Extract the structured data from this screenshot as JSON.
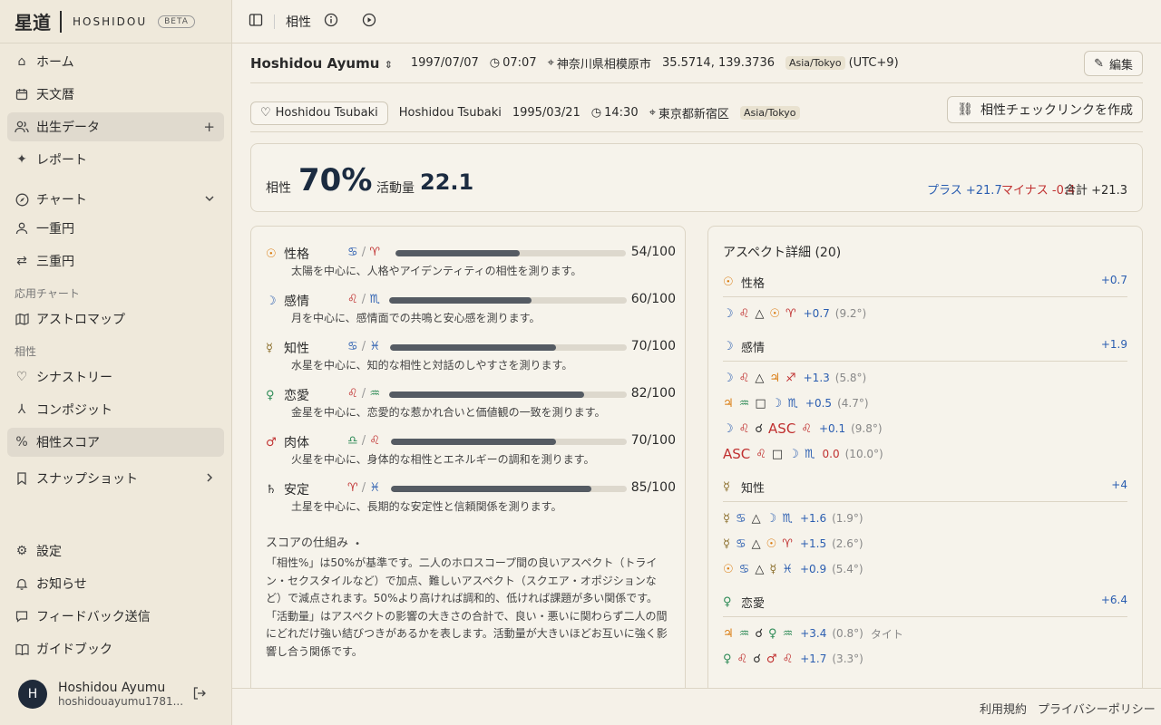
{
  "brand": {
    "kanji": "星道",
    "latin": "HOSHIDOU",
    "beta": "BETA"
  },
  "sidebar": {
    "items": [
      {
        "label": "ホーム",
        "icon": "home-icon"
      },
      {
        "label": "天文暦",
        "icon": "calendar-icon"
      },
      {
        "label": "出生データ",
        "icon": "users-icon"
      },
      {
        "label": "レポート",
        "icon": "sparkles-icon"
      },
      {
        "label": "チャート",
        "icon": "compass-icon"
      },
      {
        "label": "一重円",
        "icon": "user-icon"
      },
      {
        "label": "三重円",
        "icon": "swap-icon"
      },
      {
        "label": "アストロマップ",
        "icon": "map-icon"
      },
      {
        "label": "シナストリー",
        "icon": "heart-icon"
      },
      {
        "label": "コンポジット",
        "icon": "merge-icon"
      },
      {
        "label": "相性スコア",
        "icon": "percent-icon"
      },
      {
        "label": "スナップショット",
        "icon": "bookmark-icon"
      },
      {
        "label": "設定",
        "icon": "gear-icon"
      },
      {
        "label": "お知らせ",
        "icon": "bell-icon"
      },
      {
        "label": "フィードバック送信",
        "icon": "message-icon"
      },
      {
        "label": "ガイドブック",
        "icon": "book-icon"
      }
    ],
    "section_applied": "応用チャート",
    "section_compat": "相性"
  },
  "user": {
    "initial": "H",
    "name": "Hoshidou Ayumu",
    "email": "hoshidouayumu1781..."
  },
  "topbar": {
    "title": "相性"
  },
  "person1": {
    "name": "Hoshidou Ayumu",
    "date": "1997/07/07",
    "time": "07:07",
    "place": "神奈川県相模原市",
    "coords": "35.5714, 139.3736",
    "tz": "Asia/Tokyo",
    "offset": "(UTC+9)",
    "edit_label": "編集"
  },
  "person2": {
    "chip": "Hoshidou Tsubaki",
    "name": "Hoshidou Tsubaki",
    "date": "1995/03/21",
    "time": "14:30",
    "place": "東京都新宿区",
    "tz": "Asia/Tokyo",
    "link_label": "相性チェックリンクを作成"
  },
  "score": {
    "compat_label": "相性",
    "compat_value": "70%",
    "activity_label": "活動量",
    "activity_value": "22.1",
    "plus": "プラス +21.7",
    "minus": "マイナス -0.4",
    "total": "合計 +21.3"
  },
  "categories": [
    {
      "sym": "☉",
      "name": "性格",
      "s1": "♋",
      "s2": "♈",
      "score": 54,
      "label": "54/100",
      "desc": "太陽を中心に、人格やアイデンティティの相性を測ります。"
    },
    {
      "sym": "☽",
      "name": "感情",
      "s1": "♌",
      "s2": "♏",
      "score": 60,
      "label": "60/100",
      "desc": "月を中心に、感情面での共鳴と安心感を測ります。"
    },
    {
      "sym": "☿",
      "name": "知性",
      "s1": "♋",
      "s2": "♓",
      "score": 70,
      "label": "70/100",
      "desc": "水星を中心に、知的な相性と対話のしやすさを測ります。"
    },
    {
      "sym": "♀",
      "name": "恋愛",
      "s1": "♌",
      "s2": "♒",
      "score": 82,
      "label": "82/100",
      "desc": "金星を中心に、恋愛的な惹かれ合いと価値観の一致を測ります。"
    },
    {
      "sym": "♂",
      "name": "肉体",
      "s1": "♎",
      "s2": "♌",
      "score": 70,
      "label": "70/100",
      "desc": "火星を中心に、身体的な相性とエネルギーの調和を測ります。"
    },
    {
      "sym": "♄",
      "name": "安定",
      "s1": "♈",
      "s2": "♓",
      "score": 85,
      "label": "85/100",
      "desc": "土星を中心に、長期的な安定性と信頼関係を測ります。"
    }
  ],
  "explain": {
    "heading": "スコアの仕組み",
    "text": "「相性%」は50%が基準です。二人のホロスコープ間の良いアスペクト（トライン・セクスタイルなど）で加点、難しいアスペクト（スクエア・オポジションなど）で減点されます。50%より高ければ調和的、低ければ課題が多い関係です。「活動量」はアスペクトの影響の大きさの合計で、良い・悪いに関わらず二人の間にどれだけ強い結びつきがあるかを表します。活動量が大きいほどお互いに強く影響し合う関係です。"
  },
  "aspects": {
    "title": "アスペクト詳細 (20)",
    "groups": [
      {
        "sym": "☉",
        "name": "性格",
        "total": "+0.7",
        "rows": [
          {
            "a": "☽",
            "as": "♌",
            "asp": "△",
            "b": "☉",
            "bs": "♈",
            "score": "+0.7",
            "orb": "(9.2°)"
          }
        ]
      },
      {
        "sym": "☽",
        "name": "感情",
        "total": "+1.9",
        "rows": [
          {
            "a": "☽",
            "as": "♌",
            "asp": "△",
            "b": "♃",
            "bs": "♐",
            "score": "+1.3",
            "orb": "(5.8°)"
          },
          {
            "a": "♃",
            "as": "♒",
            "asp": "□",
            "b": "☽",
            "bs": "♏",
            "score": "+0.5",
            "orb": "(4.7°)"
          },
          {
            "a": "☽",
            "as": "♌",
            "asp": "☌",
            "b": "ASC",
            "bs": "♌",
            "score": "+0.1",
            "orb": "(9.8°)"
          },
          {
            "a": "ASC",
            "as": "♌",
            "asp": "□",
            "b": "☽",
            "bs": "♏",
            "score": "0.0",
            "orb": "(10.0°)"
          }
        ]
      },
      {
        "sym": "☿",
        "name": "知性",
        "total": "+4",
        "rows": [
          {
            "a": "☿",
            "as": "♋",
            "asp": "△",
            "b": "☽",
            "bs": "♏",
            "score": "+1.6",
            "orb": "(1.9°)"
          },
          {
            "a": "☿",
            "as": "♋",
            "asp": "△",
            "b": "☉",
            "bs": "♈",
            "score": "+1.5",
            "orb": "(2.6°)"
          },
          {
            "a": "☉",
            "as": "♋",
            "asp": "△",
            "b": "☿",
            "bs": "♓",
            "score": "+0.9",
            "orb": "(5.4°)"
          }
        ]
      },
      {
        "sym": "♀",
        "name": "恋愛",
        "total": "+6.4",
        "rows": [
          {
            "a": "♃",
            "as": "♒",
            "asp": "☌",
            "b": "♀",
            "bs": "♒",
            "score": "+3.4",
            "orb": "(0.8°)",
            "tag": "タイト"
          },
          {
            "a": "♀",
            "as": "♌",
            "asp": "☌",
            "b": "♂",
            "bs": "♌",
            "score": "+1.7",
            "orb": "(3.3°)"
          }
        ]
      }
    ]
  },
  "footer": {
    "terms": "利用規約",
    "privacy": "プライバシーポリシー"
  },
  "colors": {
    "accent": "#2a5db0",
    "negative": "#c03030",
    "bar": "#555b63"
  }
}
